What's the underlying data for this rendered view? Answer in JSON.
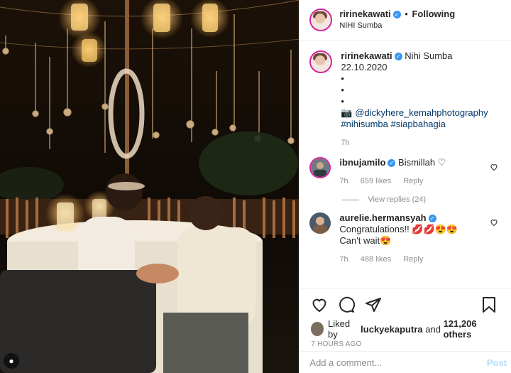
{
  "header": {
    "username": "ririnekawati",
    "separator": "•",
    "follow_state": "Following",
    "location": "NIHI Sumba"
  },
  "caption": {
    "username": "ririnekawati",
    "text": "Nihi Sumba 22.10.2020",
    "dot1": "•",
    "dot2": "•",
    "dot3": "•",
    "camera_emoji": "📷",
    "credit": "@dickyhere_kemahphotography",
    "hashtag1": "#nihisumba",
    "hashtag2": "#siapbahagia",
    "time": "7h"
  },
  "comments": [
    {
      "username": "ibnujamilo",
      "text": "Bismillah ♡",
      "time": "7h",
      "likes": "659 likes",
      "reply": "Reply",
      "view_replies": "View replies (24)"
    },
    {
      "username": "aurelie.hermansyah",
      "text_line1": "Congratulations!! 💋💋😍😍",
      "text_line2": "Can't wait😍",
      "time": "7h",
      "likes": "488 likes",
      "reply": "Reply"
    }
  ],
  "likes_summary": {
    "prefix": "Liked by",
    "user": "luckyekaputra",
    "connector": "and",
    "others": "121,206 others"
  },
  "post_date": "7 HOURS AGO",
  "add_comment": {
    "placeholder": "Add a comment...",
    "post_label": "Post"
  },
  "colors": {
    "verified_blue": "#3897f0",
    "link_blue": "#00376b",
    "post_button": "#b2dffc",
    "muted_text": "#8e8e8e"
  }
}
